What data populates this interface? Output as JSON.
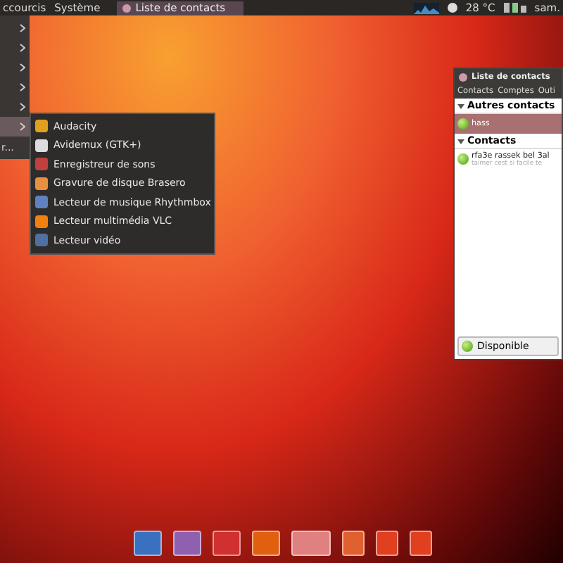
{
  "top_panel": {
    "menus": [
      "ccourcis",
      "Système"
    ],
    "task": {
      "label": "Liste de contacts",
      "selected": true
    },
    "weather": "28 °C",
    "clock": "sam."
  },
  "main_menu": {
    "items": [
      {
        "selected": false
      },
      {
        "selected": false
      },
      {
        "selected": false
      },
      {
        "selected": false
      },
      {
        "selected": false
      },
      {
        "selected": true
      }
    ],
    "footer": "r..."
  },
  "submenu": {
    "items": [
      {
        "label": "Audacity",
        "color": "#e0a020"
      },
      {
        "label": "Avidemux (GTK+)",
        "color": "#dddddd"
      },
      {
        "label": "Enregistreur de sons",
        "color": "#c04040"
      },
      {
        "label": "Gravure de disque Brasero",
        "color": "#e89040"
      },
      {
        "label": "Lecteur de musique Rhythmbox",
        "color": "#6080c0"
      },
      {
        "label": "Lecteur multimédia VLC",
        "color": "#f08010"
      },
      {
        "label": "Lecteur vidéo",
        "color": "#5070a0"
      }
    ]
  },
  "contacts_window": {
    "title": "Liste de contacts",
    "menus": [
      "Contacts",
      "Comptes",
      "Outi"
    ],
    "groups": [
      {
        "name": "Autres contacts",
        "expanded": true,
        "contacts": [
          {
            "name": "hass",
            "selected": true
          }
        ]
      },
      {
        "name": "Contacts",
        "expanded": true,
        "contacts": [
          {
            "name": "rfa3e rassek bel 3al",
            "status": "taimer cest si facile te",
            "selected": false
          }
        ]
      }
    ],
    "presence": "Disponible"
  },
  "dock": {
    "items": [
      {
        "kind": "app",
        "color": "#3a70c0"
      },
      {
        "kind": "app",
        "color": "#9060b0"
      },
      {
        "kind": "app",
        "color": "#d03030"
      },
      {
        "kind": "app",
        "color": "#e06010"
      },
      {
        "kind": "monitor",
        "color": "#e08080"
      },
      {
        "kind": "workspace",
        "color": "#e06030"
      },
      {
        "kind": "workspace",
        "color": "#e04020"
      },
      {
        "kind": "workspace",
        "color": "#e04020"
      }
    ]
  }
}
